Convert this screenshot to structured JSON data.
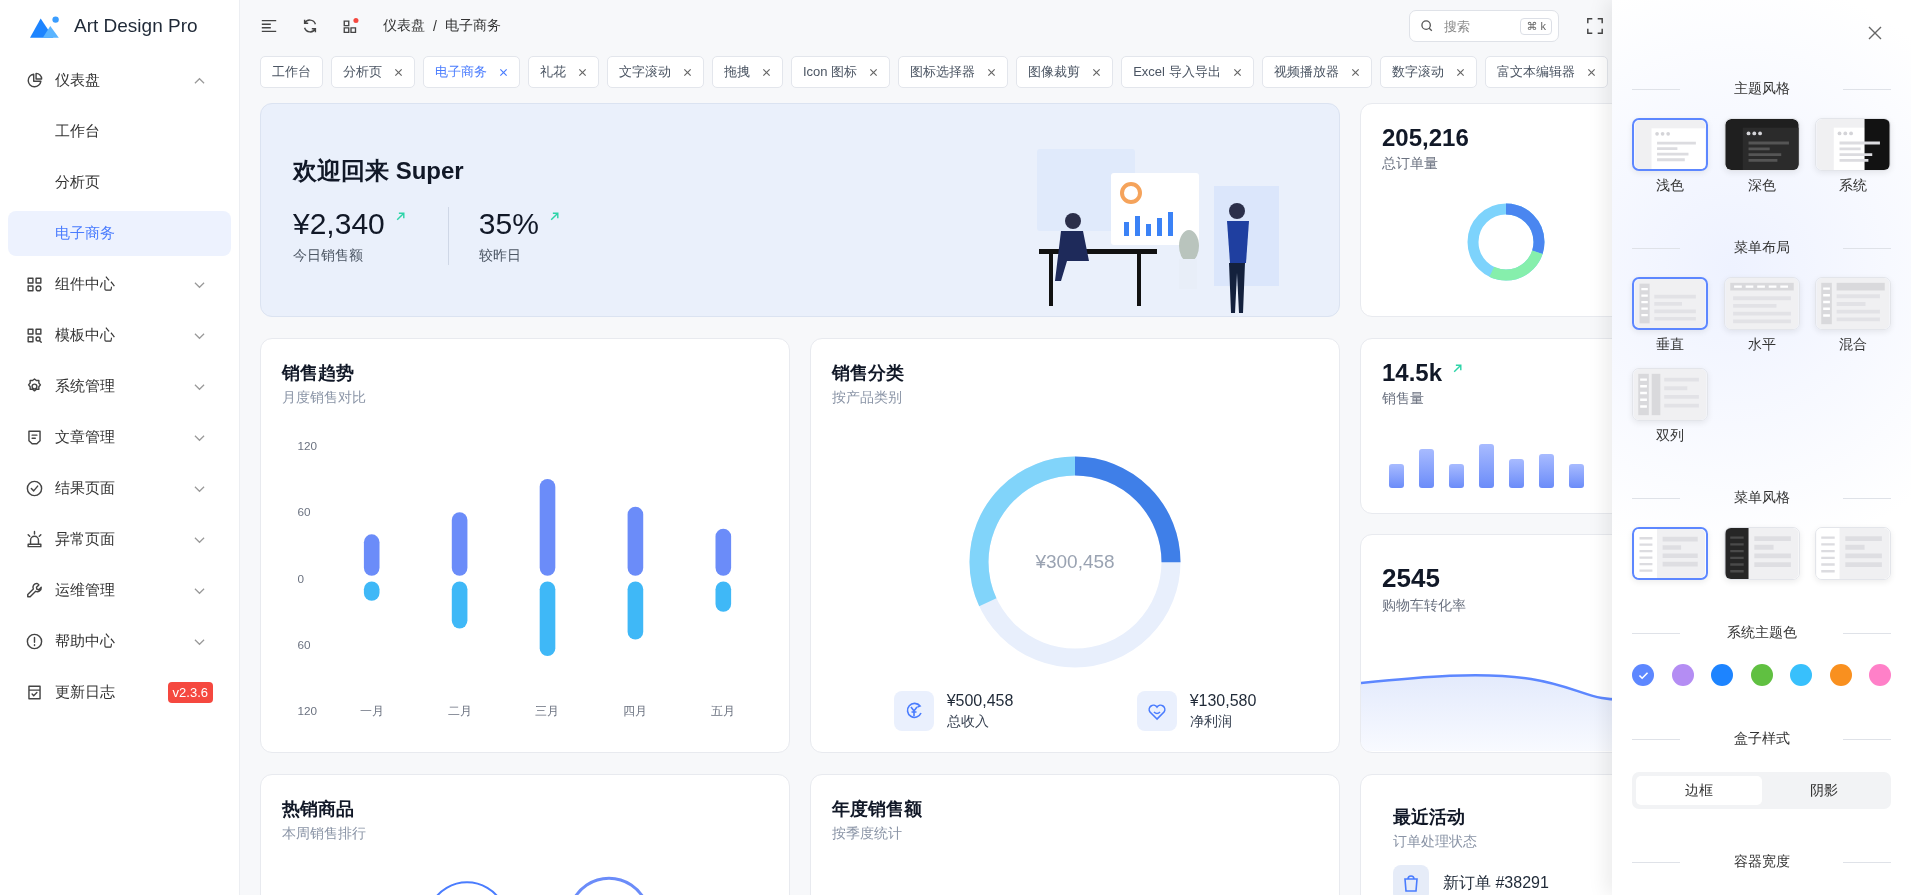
{
  "sidebar": {
    "logo": "Art Design Pro",
    "items": [
      {
        "label": "仪表盘",
        "selected": false,
        "expanded": true,
        "children": [
          {
            "label": "工作台",
            "selected": false
          },
          {
            "label": "分析页",
            "selected": false
          },
          {
            "label": "电子商务",
            "selected": true
          }
        ]
      },
      {
        "label": "组件中心",
        "selected": false,
        "expanded": false
      },
      {
        "label": "模板中心",
        "selected": false,
        "expanded": false
      },
      {
        "label": "系统管理",
        "selected": false,
        "expanded": false
      },
      {
        "label": "文章管理",
        "selected": false,
        "expanded": false
      },
      {
        "label": "结果页面",
        "selected": false,
        "expanded": false
      },
      {
        "label": "异常页面",
        "selected": false,
        "expanded": false
      },
      {
        "label": "运维管理",
        "selected": false,
        "expanded": false
      },
      {
        "label": "帮助中心",
        "selected": false,
        "expanded": false
      },
      {
        "label": "更新日志",
        "selected": false,
        "badge": "v2.3.6"
      }
    ]
  },
  "header": {
    "breadcrumb": [
      "仪表盘",
      "电子商务"
    ],
    "breadcrumb_separator": "/",
    "search": {
      "placeholder": "搜索",
      "shortcut": "⌘ k"
    }
  },
  "tabs": [
    {
      "label": "工作台",
      "selected": false,
      "closable": false
    },
    {
      "label": "分析页",
      "selected": false,
      "closable": true
    },
    {
      "label": "电子商务",
      "selected": true,
      "closable": true
    },
    {
      "label": "礼花",
      "selected": false,
      "closable": true
    },
    {
      "label": "文字滚动",
      "selected": false,
      "closable": true
    },
    {
      "label": "拖拽",
      "selected": false,
      "closable": true
    },
    {
      "label": "Icon 图标",
      "selected": false,
      "closable": true
    },
    {
      "label": "图标选择器",
      "selected": false,
      "closable": true
    },
    {
      "label": "图像裁剪",
      "selected": false,
      "closable": true
    },
    {
      "label": "Excel 导入导出",
      "selected": false,
      "closable": true
    },
    {
      "label": "视频播放器",
      "selected": false,
      "closable": true
    },
    {
      "label": "数字滚动",
      "selected": false,
      "closable": true
    },
    {
      "label": "富文本编辑器",
      "selected": false,
      "closable": true
    }
  ],
  "welcome": {
    "title": "欢迎回来 Super",
    "stats": [
      {
        "value": "¥2,340",
        "label": "今日销售额"
      },
      {
        "value": "35%",
        "label": "较昨日"
      }
    ]
  },
  "orders_card": {
    "value": "205,216",
    "label": "总订单量"
  },
  "sales_trend": {
    "title": "销售趋势",
    "subtitle": "月度销售对比",
    "chart_data": {
      "type": "bar",
      "stacked": true,
      "categories": [
        "一月",
        "二月",
        "三月",
        "四月",
        "五月"
      ],
      "series": [
        {
          "color": "#6b8cf9",
          "values": [
            40,
            60,
            90,
            65,
            45
          ]
        },
        {
          "color": "#3fb8f7",
          "values": [
            -20,
            -45,
            -70,
            -55,
            -30
          ]
        }
      ],
      "ylim": [
        -120,
        120
      ],
      "yticks": [
        {
          "value": 120,
          "label": "120"
        },
        {
          "value": 60,
          "label": "60"
        },
        {
          "value": 0,
          "label": "0"
        },
        {
          "value": -60,
          "label": "60"
        },
        {
          "value": -120,
          "label": "120"
        }
      ]
    }
  },
  "sales_category": {
    "title": "销售分类",
    "subtitle": "按产品类别",
    "center_value": "¥300,458",
    "stats": [
      {
        "value": "¥500,458",
        "label": "总收入"
      },
      {
        "value": "¥130,580",
        "label": "净利润"
      }
    ]
  },
  "sales_volume_card": {
    "value": "14.5k",
    "label": "销售量"
  },
  "conversion_card": {
    "value": "2545",
    "label": "购物车转化率"
  },
  "hot_products": {
    "title": "热销商品",
    "subtitle": "本周销售排行"
  },
  "annual_sales": {
    "title": "年度销售额",
    "subtitle": "按季度统计"
  },
  "recent_activity": {
    "title": "最近活动",
    "subtitle": "订单处理状态",
    "items": [
      {
        "text": "新订单 #38291"
      }
    ]
  },
  "settings_panel": {
    "sections": [
      {
        "title": "主题风格",
        "kind": "thumbs",
        "options": [
          {
            "kind": "light",
            "label": "浅色",
            "selected": true
          },
          {
            "kind": "dark",
            "label": "深色",
            "selected": false
          },
          {
            "kind": "system",
            "label": "系统",
            "selected": false
          }
        ]
      },
      {
        "title": "菜单布局",
        "kind": "thumbs",
        "options": [
          {
            "kind": "vertical",
            "label": "垂直",
            "selected": true
          },
          {
            "kind": "horizontal",
            "label": "水平",
            "selected": false
          },
          {
            "kind": "mixed",
            "label": "混合",
            "selected": false
          },
          {
            "kind": "dual",
            "label": "双列",
            "selected": false
          }
        ]
      },
      {
        "title": "菜单风格",
        "kind": "thumbs",
        "options": [
          {
            "kind": "menulight",
            "selected": true
          },
          {
            "kind": "menudark",
            "selected": false
          },
          {
            "kind": "menudesign",
            "selected": false
          }
        ]
      },
      {
        "title": "系统主题色",
        "kind": "colors",
        "colors": [
          {
            "color": "#5d87ff",
            "selected": true
          },
          {
            "color": "#b48df3",
            "selected": false
          },
          {
            "color": "#1d84ff",
            "selected": false
          },
          {
            "color": "#60c041",
            "selected": false
          },
          {
            "color": "#38c0fc",
            "selected": false
          },
          {
            "color": "#f9901f",
            "selected": false
          },
          {
            "color": "#ff80c8",
            "selected": false
          }
        ]
      },
      {
        "title": "盒子样式",
        "kind": "segmented",
        "options": [
          {
            "label": "边框",
            "selected": true
          },
          {
            "label": "阴影",
            "selected": false
          }
        ]
      },
      {
        "title": "容器宽度",
        "kind": "heading"
      }
    ]
  }
}
